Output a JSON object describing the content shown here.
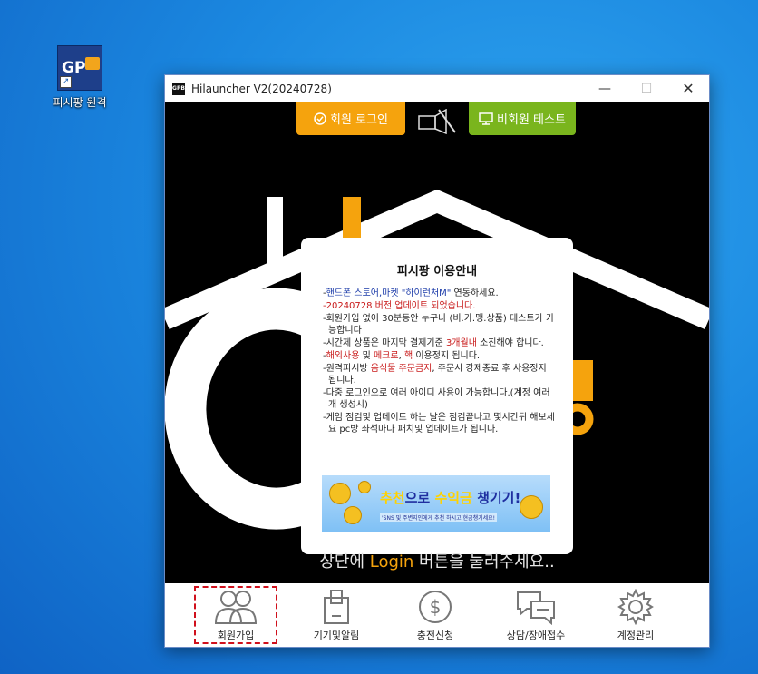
{
  "desktop": {
    "icon_label": "피시팡 원격",
    "icon_text": "GP"
  },
  "window": {
    "title": "Hilauncher V2(20240728)",
    "app_icon_text": "GPB",
    "controls": {
      "minimize": "—",
      "maximize": "☐",
      "close": "✕"
    }
  },
  "topbar": {
    "login_label": "회원 로그인",
    "guest_label": "비회원 테스트"
  },
  "notice": {
    "title": "피시팡 이용안내",
    "items": [
      {
        "parts": [
          {
            "t": "-"
          },
          {
            "t": "핸드폰 스토어,마켓 \"하이런처M\"",
            "c": "blue"
          },
          {
            "t": " 연동하세요."
          }
        ]
      },
      {
        "parts": [
          {
            "t": "-20240728 버전 업데이트 되었습니다.",
            "c": "red"
          }
        ]
      },
      {
        "parts": [
          {
            "t": "-회원가입 없이 30분동안 누구나 (비.가.맹.상품) 테스트가 가능합니다"
          }
        ]
      },
      {
        "parts": [
          {
            "t": "-시간제 상품은 마지막 결제기준 "
          },
          {
            "t": "3개월내",
            "c": "red"
          },
          {
            "t": " 소진해야 합니다."
          }
        ]
      },
      {
        "parts": [
          {
            "t": "-"
          },
          {
            "t": "해외사용",
            "c": "red"
          },
          {
            "t": " 및 "
          },
          {
            "t": "메크로",
            "c": "red"
          },
          {
            "t": ", "
          },
          {
            "t": "핵",
            "c": "red"
          },
          {
            "t": " 이용정지 됩니다."
          }
        ]
      },
      {
        "parts": [
          {
            "t": "-원격피시방 "
          },
          {
            "t": "음식물 주문금지",
            "c": "red"
          },
          {
            "t": ", 주문시 강제종료 후 사용정지 됩니다."
          }
        ]
      },
      {
        "parts": [
          {
            "t": "-다중 로그인으로 여러 아이디 사용이 가능합니다.(계정 여러개 생성시)"
          }
        ]
      },
      {
        "parts": [
          {
            "t": "-게임 점검및 업데이트 하는 날은 점검끝나고 몇시간뒤 해보세요 pc방 좌석마다 패치및 업데이트가 됩니다."
          }
        ]
      }
    ],
    "banner": {
      "main_a": "추천",
      "main_b": "으로 ",
      "main_c": "수익금",
      "main_d": " 챙기기!",
      "sub": "'SNS 및 주변지인에게 추천 하시고 현금챙기세요!"
    }
  },
  "prompt": {
    "before": "상단에 ",
    "highlight": "Login",
    "after": " 버튼을 눌러주세요.."
  },
  "nav": [
    {
      "id": "signup",
      "label": "회원가입",
      "icon": "people-icon",
      "selected": true
    },
    {
      "id": "devices",
      "label": "기기및알림",
      "icon": "device-icon",
      "selected": false
    },
    {
      "id": "charge",
      "label": "충전신청",
      "icon": "dollar-coin-icon",
      "selected": false
    },
    {
      "id": "support",
      "label": "상담/장애접수",
      "icon": "chat-bubbles-icon",
      "selected": false
    },
    {
      "id": "account",
      "label": "계정관리",
      "icon": "gear-icon",
      "selected": false
    }
  ],
  "colors": {
    "accent_orange": "#f5a30d",
    "accent_green": "#7ab51d",
    "selection_red": "#d0101c"
  }
}
